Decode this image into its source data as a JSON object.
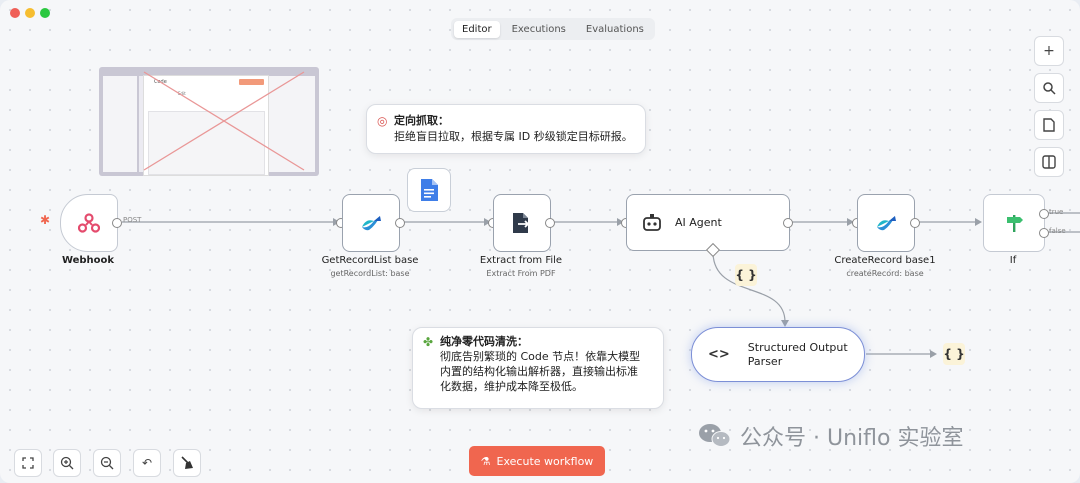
{
  "tabs": [
    {
      "label": "Editor"
    },
    {
      "label": "Executions"
    },
    {
      "label": "Evaluations"
    }
  ],
  "thumbnail": {
    "title": "Code",
    "edit_label": "Edit"
  },
  "callouts": {
    "targeted": {
      "title": "定向抓取：",
      "body": "拒绝盲目拉取，根据专属 ID 秒级锁定目标研报。"
    },
    "pure": {
      "title": "纯净零代码清洗：",
      "lines": [
        "彻底告别繁琐的 Code 节点！依靠大模型",
        "内置的结构化输出解析器，直接输出标准",
        "化数据，维护成本降至极低。"
      ]
    }
  },
  "nodes": {
    "webhook": {
      "label": "Webhook",
      "method": "POST"
    },
    "get_record_list": {
      "label": "GetRecordList base",
      "sub": "getRecordList: base"
    },
    "extract": {
      "label": "Extract from File",
      "sub": "Extract From PDF"
    },
    "ai_agent": {
      "label": "AI Agent"
    },
    "parser": {
      "label_line1": "Structured Output",
      "label_line2": "Parser"
    },
    "create_record": {
      "label": "CreateRecord base1",
      "sub": "createRecord: base"
    },
    "if_node": {
      "label": "If",
      "true_label": "true",
      "false_label": "false"
    }
  },
  "brace_label": "{ }",
  "execute_label": "Execute workflow",
  "watermark": "公众号 · Uniflo 实验室",
  "colors": {
    "accent": "#f0664f",
    "bg": "#f6f7f9",
    "brace": "#fbf3d8",
    "webhook": "#e44b6d",
    "doc": "#3f7ee8"
  }
}
